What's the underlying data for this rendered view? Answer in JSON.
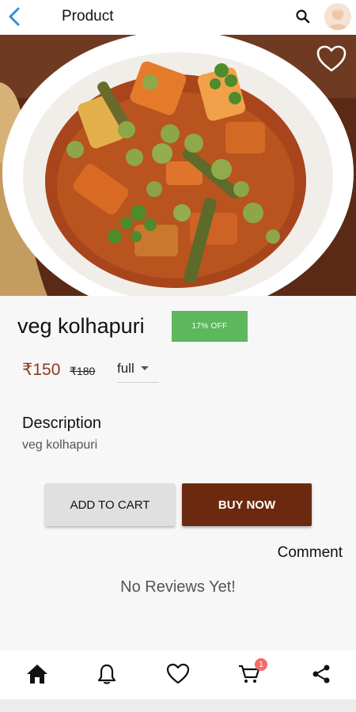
{
  "header": {
    "title": "Product",
    "back_icon": "chevron-left-icon",
    "search_icon": "search-icon",
    "avatar_icon": "user-avatar-icon"
  },
  "product": {
    "name": "veg kolhapuri",
    "offer": "17% OFF",
    "price": "₹150",
    "mrp": "₹180",
    "size": "full",
    "description_heading": "Description",
    "description": "veg kolhapuri"
  },
  "actions": {
    "add_to_cart": "ADD TO CART",
    "buy_now": "BUY NOW",
    "comment": "Comment"
  },
  "reviews": {
    "empty": "No Reviews Yet!"
  },
  "bottom_nav": {
    "items": [
      "home-icon",
      "bell-icon",
      "heart-icon",
      "cart-icon",
      "share-icon"
    ],
    "cart_badge": "1"
  },
  "colors": {
    "accent_brown": "#6b2a10",
    "offer_green": "#5cb75d",
    "price_color": "#8a3a1c",
    "back_blue": "#2f8ee0",
    "badge_red": "#f36b6b"
  }
}
